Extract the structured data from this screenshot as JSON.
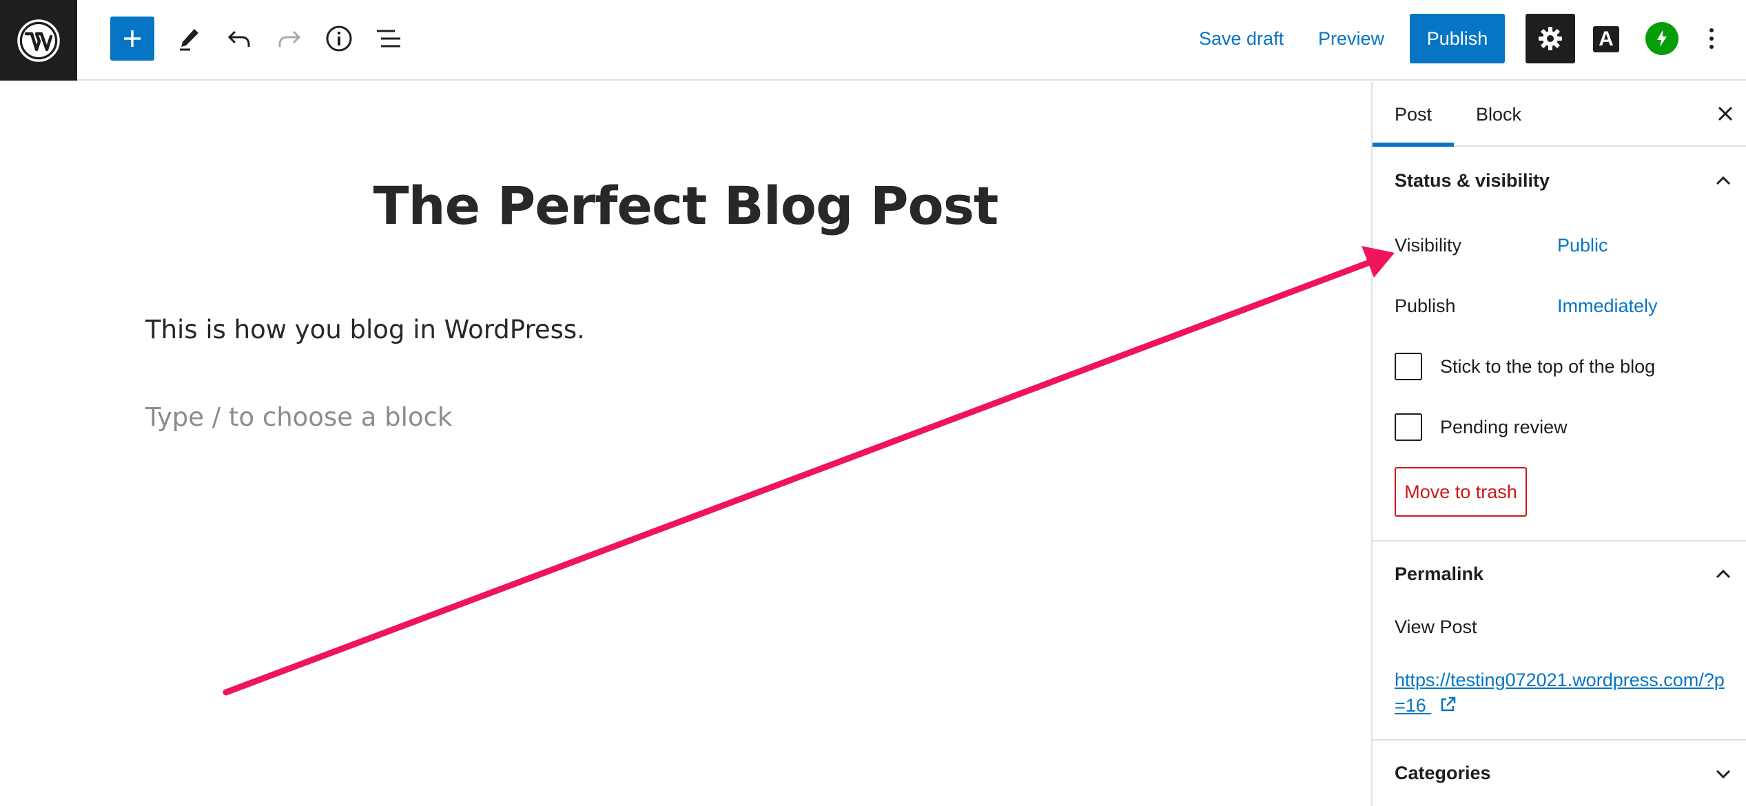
{
  "toolbar": {
    "wordpress_logo": "wordpress-logo",
    "icons": [
      "add-block-icon",
      "pencil-icon",
      "undo-icon",
      "redo-icon",
      "info-icon",
      "list-view-icon",
      "gear-icon",
      "amp-icon",
      "jetpack-icon",
      "more-vertical-icon"
    ],
    "save_draft_label": "Save draft",
    "preview_label": "Preview",
    "publish_label": "Publish",
    "amp_letter": "A"
  },
  "editor": {
    "title": "The Perfect Blog Post",
    "paragraph": "This is how you blog in WordPress.",
    "placeholder": "Type / to choose a block"
  },
  "sidebar": {
    "tabs": [
      {
        "label": "Post",
        "active": true
      },
      {
        "label": "Block",
        "active": false
      }
    ],
    "status_panel": {
      "title": "Status & visibility",
      "expanded": true,
      "visibility_label": "Visibility",
      "visibility_value": "Public",
      "publish_label": "Publish",
      "publish_value": "Immediately",
      "sticky_label": "Stick to the top of the blog",
      "sticky_checked": false,
      "pending_label": "Pending review",
      "pending_checked": false,
      "trash_label": "Move to trash"
    },
    "permalink_panel": {
      "title": "Permalink",
      "expanded": true,
      "view_post_label": "View Post",
      "url": "https://testing072021.wordpress.com/?p=16"
    },
    "categories_panel": {
      "title": "Categories",
      "expanded": false
    }
  },
  "colors": {
    "accent": "#0675c4",
    "dark": "#1e1e1e",
    "danger": "#cc1818",
    "jetpack_green": "#069e08",
    "annotation_arrow": "#f0145a"
  }
}
